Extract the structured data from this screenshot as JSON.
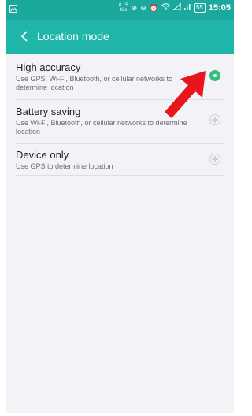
{
  "status_bar": {
    "speed": "0.15",
    "speed_unit": "K/s",
    "battery": "55",
    "time": "15:05",
    "icons": [
      "image-icon",
      "data-saver-icon",
      "do-not-disturb-icon",
      "alarm-icon",
      "wifi-icon",
      "signal-icon",
      "signal-icon",
      "battery-icon"
    ]
  },
  "header": {
    "title": "Location mode",
    "back_icon": "back-chevron-icon"
  },
  "options": [
    {
      "title": "High accuracy",
      "subtitle": "Use GPS, Wi-Fi, Bluetooth, or cellular networks to determine location",
      "selected": true
    },
    {
      "title": "Battery saving",
      "subtitle": "Use Wi-Fi, Bluetooth, or cellular networks to determine location",
      "selected": false
    },
    {
      "title": "Device only",
      "subtitle": "Use GPS to determine location",
      "selected": false
    }
  ],
  "colors": {
    "status_bar": "#1aa99c",
    "app_bar": "#1fb6a9",
    "selected_radio": "#2ec27e",
    "annotation_arrow": "#e8161c",
    "background": "#f3f2f7"
  }
}
